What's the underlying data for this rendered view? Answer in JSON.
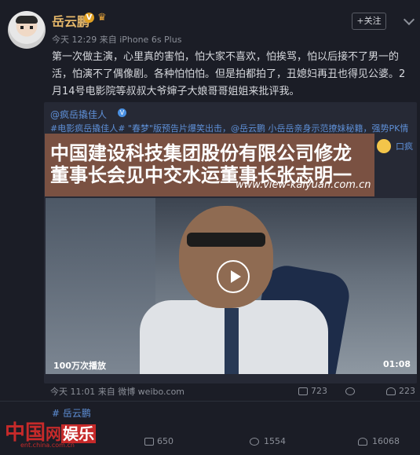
{
  "author": {
    "name": "岳云鹏",
    "meta": "今天 12:29 来自 iPhone 6s Plus"
  },
  "follow_label": "+关注",
  "post_text": "第一次做主演，心里真的害怕，怕大家不喜欢，怕挨骂，怕以后接不了男一的活，怕演不了偶像剧。各种怕怕怕。但是拍都拍了，丑媳妇再丑也得见公婆。2月14号电影院等叔叔大爷婶子大娘哥哥姐姐来批评我。",
  "repost": {
    "user": "@疯岳撬佳人",
    "text": "#电影疯岳撬佳人# \"春梦\"版预告片爆笑出击，@岳云鹏 小岳岳亲身示范撩妹秘籍，强势PK情",
    "reply_label": "口疯",
    "time": "今天 11:01 来自 微博 weibo.com",
    "likes": "223",
    "shares": "723"
  },
  "banner": {
    "line1": "中国建设科技集团股份有限公司修龙",
    "line2": "董事长会见中交水运董事长张志明一",
    "url": "www.view-kaiyuan.com.cn"
  },
  "video": {
    "views": "100万次播放",
    "duration": "01:08"
  },
  "tag": "# 岳云鹏",
  "footer": {
    "reposts": "650",
    "comments": "1554",
    "likes": "16068"
  },
  "watermark": {
    "brand_a": "中国",
    "brand_b": "网",
    "brand_c": "娱乐",
    "url": "ent.china.com.cn"
  },
  "colors": {
    "background": "#1b1d26",
    "accent_name": "#e6b86a",
    "link": "#5e8fd6",
    "banner_bg": "#925c46"
  }
}
